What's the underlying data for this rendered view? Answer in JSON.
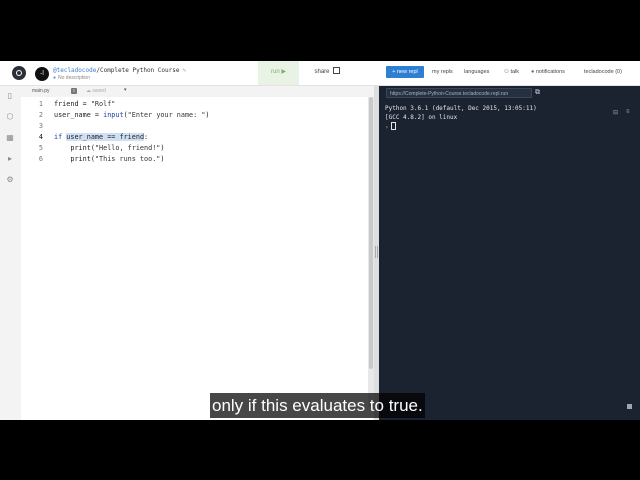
{
  "header": {
    "avatar_text": "-l",
    "user": "@tecladocode",
    "separator": "/",
    "project": "Complete Python Course",
    "pen": "✎",
    "description": "No description",
    "run_label": "run ▶",
    "share_label": "share",
    "new_repl_label": "+ new repl",
    "nav": {
      "my_repls": "my repls",
      "languages": "languages",
      "talk": "talk",
      "notifications": "notifications",
      "account": "tecladocode (0)"
    }
  },
  "sidebar": {
    "icons": [
      "files-icon",
      "packages-icon",
      "database-icon",
      "debugger-icon",
      "settings-icon"
    ]
  },
  "tabs": {
    "file": "main.py",
    "saved": "saved",
    "caret": "▾"
  },
  "editor": {
    "line_numbers": [
      "1",
      "2",
      "3",
      "4",
      "5",
      "6"
    ],
    "line1": {
      "a": "friend = ",
      "b": "\"Rolf\""
    },
    "line2": {
      "a": "user_name = ",
      "b": "input",
      "c": "(",
      "d": "\"Enter your name: \"",
      "e": ")"
    },
    "line4": {
      "kw": "if ",
      "sel": "user_name == friend",
      "rest": ":"
    },
    "line5": {
      "a": "    print(",
      "b": "\"Hello, friend!\"",
      "c": ")"
    },
    "line6": {
      "a": "    print(",
      "b": "\"This runs too.\"",
      "c": ")"
    }
  },
  "console": {
    "url": "https://Complete-Python-Course.tecladocode.repl.run",
    "lines": [
      "Python 3.6.1 (default, Dec 2015, 13:05:11)",
      "[GCC 4.8.2] on linux"
    ],
    "prompt": "›"
  },
  "caption": "only if this evaluates to true.",
  "colors": {
    "accent": "#2e7fd4",
    "console_bg": "#1b2331",
    "run_bg": "#e9f3e5",
    "prompt": "#f2a23a"
  }
}
